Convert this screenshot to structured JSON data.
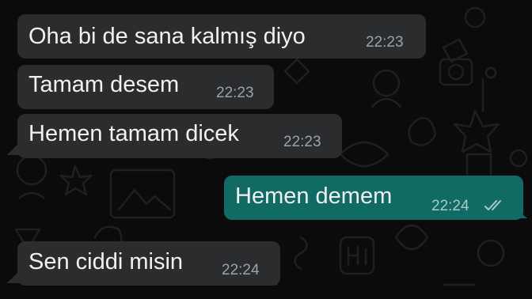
{
  "messages": [
    {
      "direction": "incoming",
      "text": "Oha bi de sana kalmış diyo",
      "time": "22:23"
    },
    {
      "direction": "incoming",
      "text": "Tamam desem",
      "time": "22:23"
    },
    {
      "direction": "incoming",
      "text": "Hemen tamam dicek",
      "time": "22:23"
    },
    {
      "direction": "outgoing",
      "text": "Hemen demem",
      "time": "22:24",
      "status_icon": "double-check-read-icon"
    },
    {
      "direction": "incoming",
      "text": "Sen ciddi misin",
      "time": "22:24"
    }
  ],
  "colors": {
    "background": "#0b0b0b",
    "incoming_bubble": "#2b2c2e",
    "outgoing_bubble": "#0f6b63",
    "text": "#f1f1f1",
    "timestamp": "#9aa3a6"
  }
}
